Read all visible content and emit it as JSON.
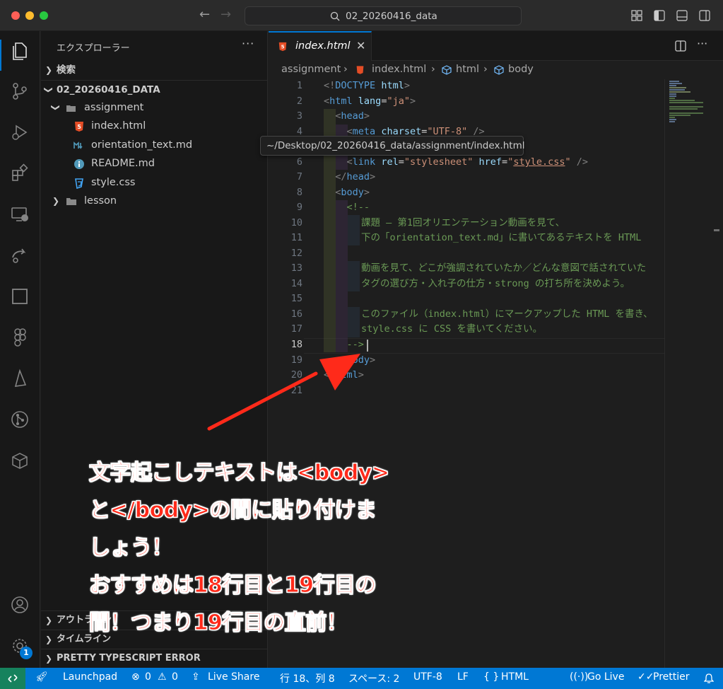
{
  "titlebar": {
    "search_text": "02_20260416_data"
  },
  "sidebar": {
    "title": "エクスプローラー",
    "more": "···",
    "search_section": "検索",
    "root_folder": "02_20260416_DATA",
    "items": [
      {
        "label": "assignment",
        "type": "folder-open"
      },
      {
        "label": "index.html",
        "type": "html"
      },
      {
        "label": "orientation_text.md",
        "type": "markdown"
      },
      {
        "label": "README.md",
        "type": "info"
      },
      {
        "label": "style.css",
        "type": "css"
      },
      {
        "label": "lesson",
        "type": "folder"
      }
    ],
    "outline_section": "アウトライン",
    "timeline_section": "タイムライン",
    "ts_error_section": "PRETTY TYPESCRIPT ERROR"
  },
  "editor": {
    "tab_label": "index.html",
    "tab_close": "✕",
    "breadcrumb": [
      "assignment",
      "index.html",
      "html",
      "body"
    ],
    "tooltip": "~/Desktop/02_20260416_data/assignment/index.html",
    "line_numbers": [
      "1",
      "2",
      "3",
      "4",
      "5",
      "6",
      "7",
      "8",
      "9",
      "10",
      "11",
      "12",
      "13",
      "14",
      "15",
      "16",
      "17",
      "18",
      "19",
      "20",
      "21"
    ],
    "active_line": "18",
    "comment_lines": {
      "l10": "課題 – 第1回オリエンテーション動画を見て、",
      "l11": "下の「orientation_text.md」に書いてあるテキストを HTML",
      "l13": "動画を見て、どこが強調されていたか／どんな意図で話されていた",
      "l14": "タグの選び方・入れ子の仕方・strong の打ち所を決めよう。",
      "l16": "このファイル（index.html）にマークアップした HTML を書き、",
      "l17": "style.css に CSS を書いてください。"
    }
  },
  "annotation": {
    "lines": [
      "文字起こしテキストは<body>",
      "と</body>の間に貼り付けま",
      "しょう！",
      "おすすめは18行目と19行目の",
      "間！つまり19行目の直前！"
    ],
    "color": "#ff2a1a"
  },
  "statusbar": {
    "launchpad": "Launchpad",
    "errors": "0",
    "warnings": "0",
    "live_share": "Live Share",
    "position": "行 18、列 8",
    "spaces": "スペース: 2",
    "encoding": "UTF-8",
    "eol": "LF",
    "language": "HTML",
    "go_live": "Go Live",
    "prettier": "Prettier"
  },
  "activity_badge": "1",
  "colors": {
    "accent": "#0078d4",
    "statusbar": "#0078d4",
    "remote": "#16825d"
  }
}
